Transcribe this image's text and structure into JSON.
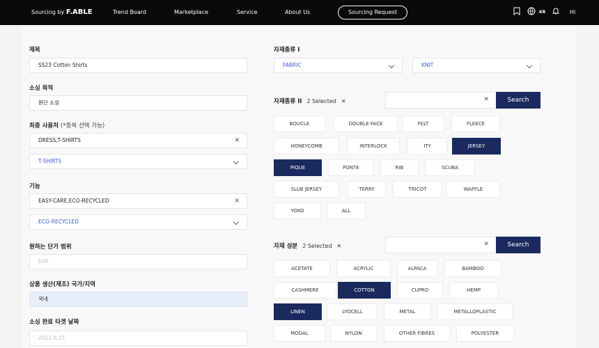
{
  "nav": {
    "brand_prefix": "Sourcing by",
    "brand_name": "F.ABLE",
    "links": [
      "Trend Board",
      "Marketplace",
      "Service",
      "About Us"
    ],
    "sourcing_request": "Sourcing Request",
    "lang": "KR",
    "greeting": "Hi"
  },
  "left": {
    "title_label": "제목",
    "title_value": "SS23 Cotton Shirts",
    "purpose_label": "소싱 목적",
    "purpose_value": "원단 소싱",
    "enduse_label": "최종 사용처",
    "enduse_sub": "(*중복 선택 가능)",
    "enduse_value": "DRESS,T-SHIRTS",
    "enduse_select": "T-SHIRTS",
    "function_label": "기능",
    "function_value": "EASY-CARE,ECO-RECYCLED",
    "function_select": "ECO-RECYCLED",
    "price_label": "원하는 단가 범위",
    "price_placeholder": "Edit",
    "country_label": "상품 생산(제조) 국가/지역",
    "country_value": "국내",
    "date_label": "소싱 완료 타겟 날짜",
    "date_placeholder": "2022.8.25"
  },
  "right": {
    "type1_label": "자재종류 I",
    "type1_select1": "FABRIC",
    "type1_select2": "KNIT",
    "type2_label": "자재종류 II",
    "type2_count": "2 Selected",
    "search_label": "Search",
    "composition_label": "자재 성분",
    "composition_count": "2 Selected"
  },
  "type2_chips": [
    {
      "label": "BOUCLE",
      "selected": false
    },
    {
      "label": "DOUBLE-FACE",
      "selected": false
    },
    {
      "label": "FELT",
      "selected": false
    },
    {
      "label": "FLEECE",
      "selected": false
    },
    {
      "label": "HONEYCOMB",
      "selected": false
    },
    {
      "label": "INTERLOCK",
      "selected": false
    },
    {
      "label": "ITY",
      "selected": false
    },
    {
      "label": "JERSEY",
      "selected": true
    },
    {
      "label": "PIQUE",
      "selected": true
    },
    {
      "label": "PONTE",
      "selected": false
    },
    {
      "label": "RIB",
      "selected": false
    },
    {
      "label": "SCUBA",
      "selected": false
    },
    {
      "label": "SLUB JERSEY",
      "selected": false
    },
    {
      "label": "TERRY",
      "selected": false
    },
    {
      "label": "TRICOT",
      "selected": false
    },
    {
      "label": "WAFFLE",
      "selected": false
    },
    {
      "label": "YOKO",
      "selected": false
    },
    {
      "label": "ALL",
      "selected": false
    }
  ],
  "composition_chips": [
    {
      "label": "ACETATE",
      "selected": false
    },
    {
      "label": "ACRYLIC",
      "selected": false
    },
    {
      "label": "ALPACA",
      "selected": false
    },
    {
      "label": "BAMBOO",
      "selected": false
    },
    {
      "label": "CASHMERE",
      "selected": false
    },
    {
      "label": "COTTON",
      "selected": true
    },
    {
      "label": "CUPRO",
      "selected": false
    },
    {
      "label": "HEMP",
      "selected": false
    },
    {
      "label": "LINEN",
      "selected": true
    },
    {
      "label": "LYOCELL",
      "selected": false
    },
    {
      "label": "METAL",
      "selected": false
    },
    {
      "label": "METALLOPLASTIC",
      "selected": false
    },
    {
      "label": "MODAL",
      "selected": false
    },
    {
      "label": "NYLON",
      "selected": false
    },
    {
      "label": "OTHER FIBRES",
      "selected": false
    },
    {
      "label": "POLYESTER",
      "selected": false
    }
  ],
  "colors": {
    "navy": "#1b2a5e",
    "link_blue": "#3b5bd6",
    "nav_bg": "#0a0a0a"
  }
}
